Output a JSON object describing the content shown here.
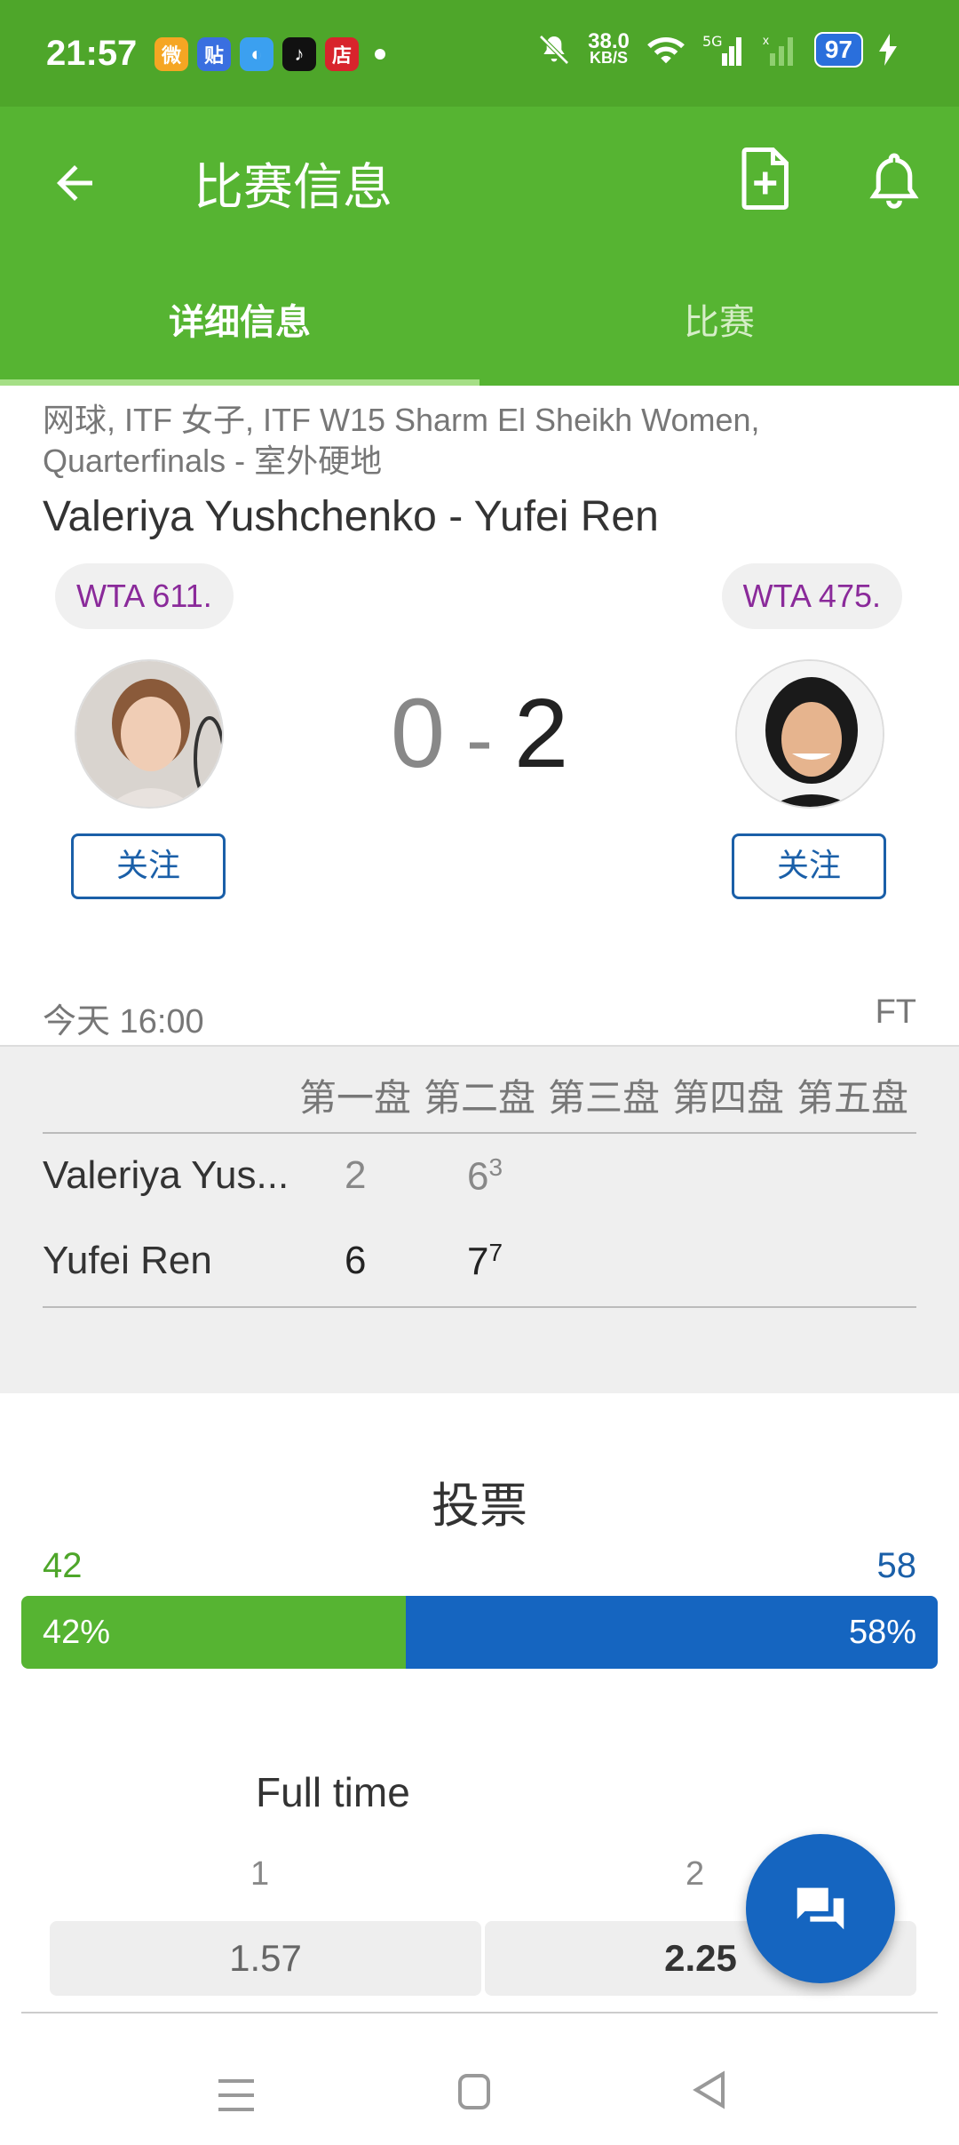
{
  "status_bar": {
    "time": "21:57",
    "apps": [
      {
        "name": "weibo-icon",
        "label": "微",
        "color": "#f5a623"
      },
      {
        "name": "tieba-icon",
        "label": "贴",
        "color": "#3a6fe0"
      },
      {
        "name": "browser-icon",
        "label": "◐",
        "color": "#3ba0f0"
      },
      {
        "name": "douyin-icon",
        "label": "♪",
        "color": "#111111"
      },
      {
        "name": "store-icon",
        "label": "店",
        "color": "#d8242c"
      }
    ],
    "net_speed_value": "38.0",
    "net_speed_unit": "KB/S",
    "battery": "97"
  },
  "appbar": {
    "title": "比赛信息"
  },
  "tabs": [
    {
      "label": "详细信息",
      "active": true
    },
    {
      "label": "比赛",
      "active": false
    }
  ],
  "match": {
    "breadcrumb": "网球, ITF 女子, ITF W15 Sharm El Sheikh Women, Quarterfinals - 室外硬地",
    "name": "Valeriya Yushchenko - Yufei Ren",
    "home_rank": "WTA 611.",
    "away_rank": "WTA 475.",
    "score_home": "0",
    "score_sep": "-",
    "score_away": "2",
    "follow_label": "关注",
    "date": "今天 16:00",
    "status": "FT"
  },
  "sets": {
    "headers": [
      "第一盘",
      "第二盘",
      "第三盘",
      "第四盘",
      "第五盘"
    ],
    "rows": [
      {
        "player": "Valeriya Yus...",
        "s1": "2",
        "s2": "6",
        "s2_tb": "3"
      },
      {
        "player": "Yufei Ren",
        "s1": "6",
        "s2": "7",
        "s2_tb": "7"
      }
    ]
  },
  "vote": {
    "title": "投票",
    "home_count": "42",
    "away_count": "58",
    "home_pct_label": "42%",
    "away_pct_label": "58%",
    "home_fraction": 0.42
  },
  "odds": {
    "title": "Full time",
    "label_1": "1",
    "label_2": "2",
    "value_1": "1.57",
    "value_2": "2.25"
  },
  "colors": {
    "header_green": "#56b432",
    "vote_blue": "#1565c0",
    "rank_purple": "#8a2a9a"
  }
}
